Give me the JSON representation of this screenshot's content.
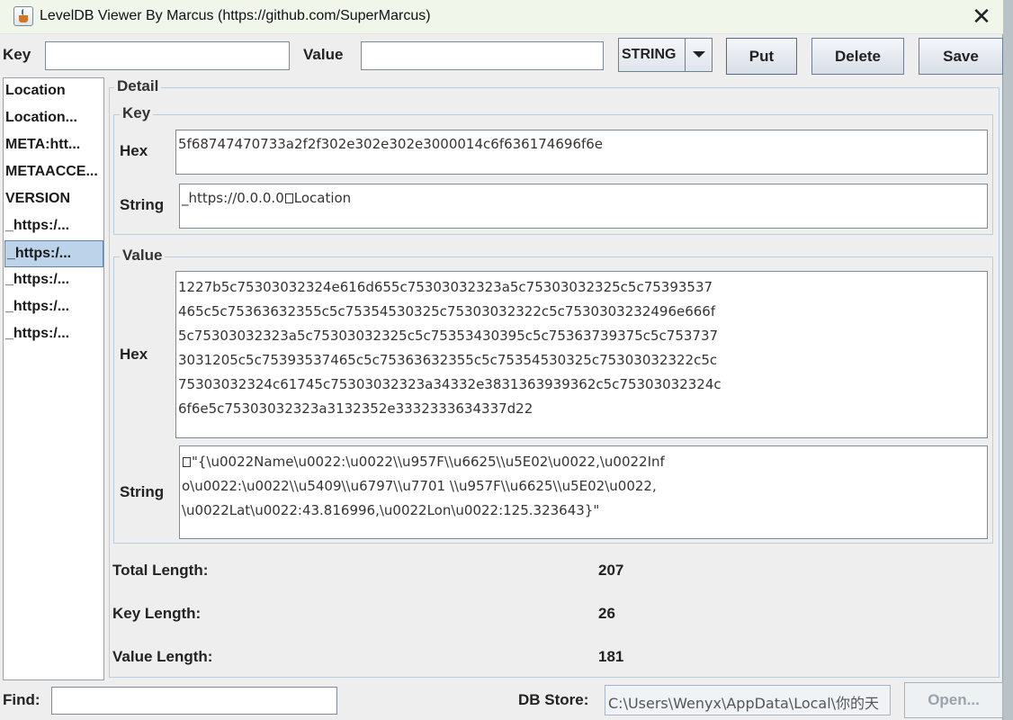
{
  "window": {
    "title": "LevelDB Viewer By Marcus (https://github.com/SuperMarcus)",
    "close_symbol": "✕"
  },
  "toolbar": {
    "key_label": "Key",
    "key_value": "",
    "value_label": "Value",
    "value_value": "",
    "type_selected": "STRING",
    "put_label": "Put",
    "delete_label": "Delete",
    "save_label": "Save"
  },
  "keys_list": [
    {
      "label": "Location"
    },
    {
      "label": "Location..."
    },
    {
      "label": "META:htt..."
    },
    {
      "label": "METAACCE..."
    },
    {
      "label": "VERSION"
    },
    {
      "label": "_https:/..."
    },
    {
      "label": "_https:/..."
    },
    {
      "label": "_https:/..."
    },
    {
      "label": "_https:/..."
    },
    {
      "label": "_https:/..."
    }
  ],
  "detail": {
    "title": "Detail",
    "key": {
      "title": "Key",
      "hex_label": "Hex",
      "hex_value": "5f68747470733a2f2f302e302e302e3000014c6f636174696f6e",
      "string_label": "String",
      "string_prefix": "_https://0.0.0.0",
      "string_suffix": "Location"
    },
    "value": {
      "title": "Value",
      "hex_label": "Hex",
      "hex_lines": [
        "1227b5c75303032324e616d655c75303032323a5c75303032325c5c75393537",
        "465c5c75363632355c5c75354530325c75303032322c5c7530303232496e666f",
        "5c75303032323a5c75303032325c5c75353430395c5c75363739375c5c753737",
        "3031205c5c75393537465c5c75363632355c5c75354530325c75303032322c5c",
        "75303032324c61745c75303032323a34332e3831363939362c5c75303032324c",
        "6f6e5c75303032323a3132352e3332333634337d22"
      ],
      "string_label": "String",
      "string_lines": [
        "\"{\\u0022Name\\u0022:\\u0022\\\\u957F\\\\u6625\\\\u5E02\\u0022,\\u0022Inf",
        "o\\u0022:\\u0022\\\\u5409\\\\u6797\\\\u7701 \\\\u957F\\\\u6625\\\\u5E02\\u0022,",
        "\\u0022Lat\\u0022:43.816996,\\u0022Lon\\u0022:125.323643}\""
      ]
    },
    "total_length_label": "Total Length:",
    "total_length": "207",
    "key_length_label": "Key Length:",
    "key_length": "26",
    "value_length_label": "Value Length:",
    "value_length": "181"
  },
  "footer": {
    "find_label": "Find:",
    "find_value": "",
    "db_store_label": "DB Store:",
    "db_store_path": "C:\\Users\\Wenyx\\AppData\\Local\\你的天",
    "open_label": "Open..."
  },
  "icons": {
    "app": "java-coffee-cup-icon",
    "close": "close-icon",
    "dropdown": "chevron-down-icon"
  }
}
